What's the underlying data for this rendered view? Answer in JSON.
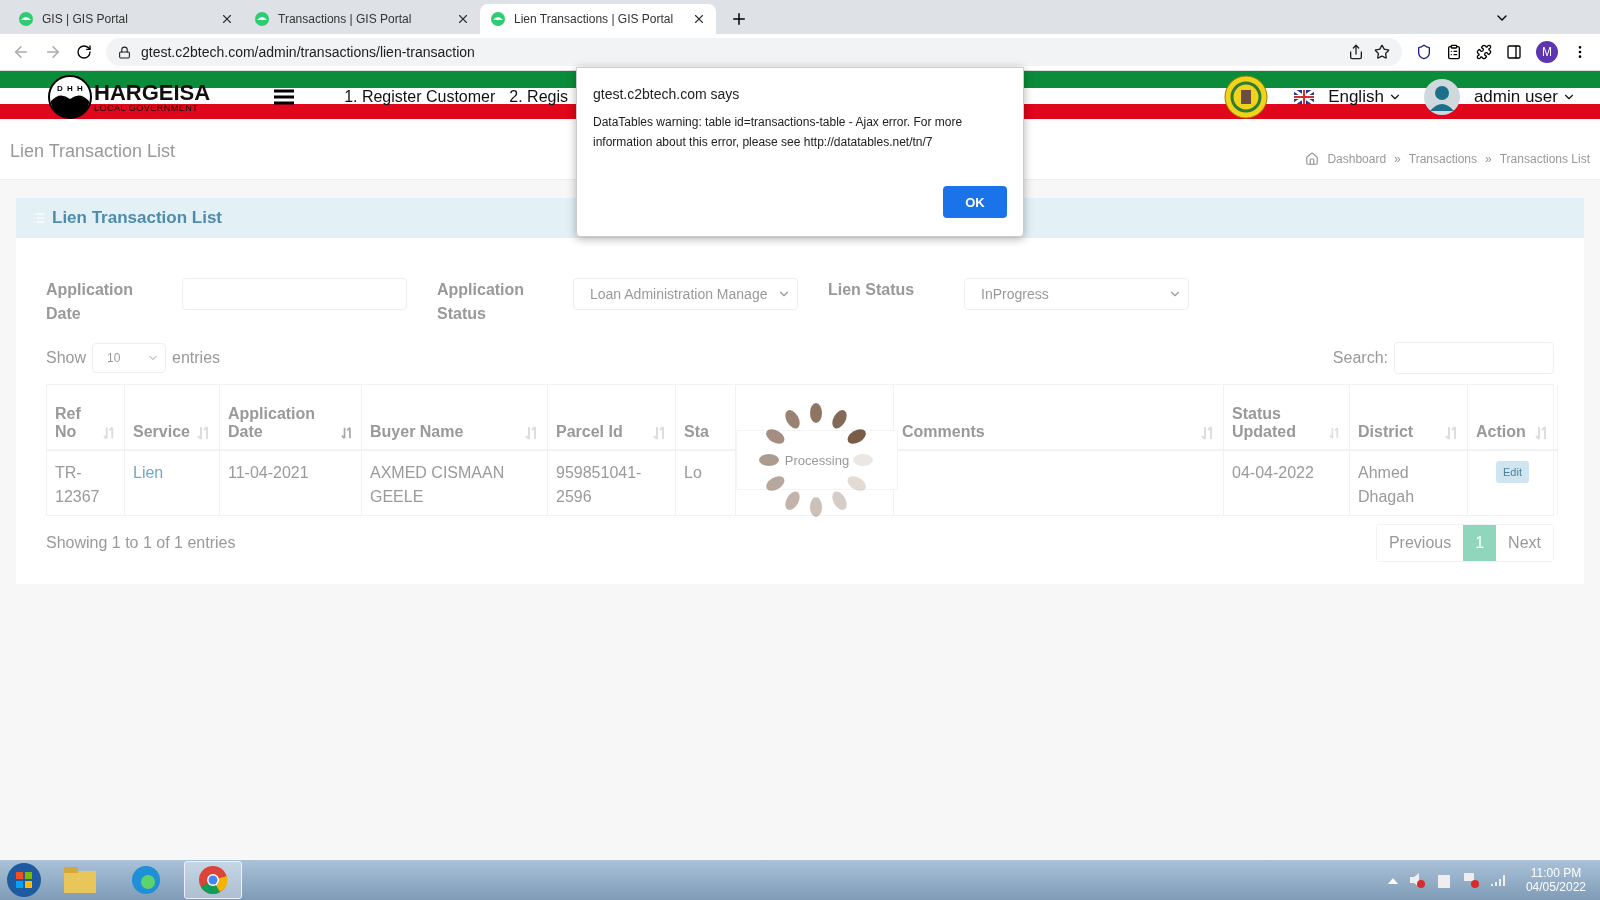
{
  "browser": {
    "tabs": [
      {
        "title": "GIS | GIS Portal",
        "selected": false
      },
      {
        "title": "Transactions | GIS Portal",
        "selected": false
      },
      {
        "title": "Lien Transactions | GIS Portal",
        "selected": true
      }
    ],
    "url": "gtest.c2btech.com/admin/transactions/lien-transaction",
    "profile": "M"
  },
  "site": {
    "logo": {
      "letters": [
        "D",
        "H",
        "H"
      ],
      "title": "HARGEISA",
      "subtitle": "LOCAL GOVERNMENT"
    },
    "nav": [
      "1. Register Customer",
      "2. Regis"
    ],
    "language": "English",
    "user": "admin user"
  },
  "page": {
    "title": "Lien Transaction List",
    "breadcrumbs": [
      {
        "label": "Dashboard"
      },
      {
        "separator": "»",
        "label": "Transactions"
      },
      {
        "separator": "»",
        "label": "Transactions List"
      }
    ]
  },
  "card": {
    "title": "Lien Transaction List",
    "filters": [
      {
        "label": "Application Date",
        "kind": "input"
      },
      {
        "label": "Application Status",
        "kind": "select",
        "value": "Loan Administration Manage"
      },
      {
        "label": "Lien Status",
        "kind": "select",
        "value": "InProgress"
      }
    ],
    "show": "Show",
    "length": "10",
    "entries": "entries",
    "search": "Search:",
    "columns": [
      {
        "label": "Ref No",
        "sorted": false
      },
      {
        "label": "Service",
        "sorted": false
      },
      {
        "label": "Application Date",
        "sorted": true
      },
      {
        "label": "Buyer Name",
        "sorted": false
      },
      {
        "label": "Parcel Id",
        "sorted": false
      },
      {
        "label": "Sta",
        "sorted": false
      },
      {
        "label": "Comments",
        "sorted": false
      },
      {
        "label": "Status Updated",
        "sorted": false
      },
      {
        "label": "District",
        "sorted": false
      },
      {
        "label": "Action",
        "sorted": false
      }
    ],
    "rows": [
      {
        "cells": [
          "TR-12367",
          "Lien",
          "11-04-2021",
          "AXMED CISMAAN GEELE",
          "959851041-2596",
          "Lo",
          "",
          "04-04-2022",
          "Ahmed Dhagah"
        ],
        "action": "Edit"
      }
    ],
    "info": "Showing 1 to 1 of 1 entries",
    "pagination": [
      {
        "label": "Previous",
        "selected": false
      },
      {
        "label": "1",
        "selected": true
      },
      {
        "label": "Next",
        "selected": false
      }
    ],
    "processing": "Processing"
  },
  "dialog": {
    "origin": "gtest.c2btech.com says",
    "message": "DataTables warning: table id=transactions-table - Ajax error. For more information about this error, please see http://datatables.net/tn/7",
    "ok": "OK"
  },
  "taskbar": {
    "time": "11:00 PM",
    "date": "04/05/2022"
  }
}
